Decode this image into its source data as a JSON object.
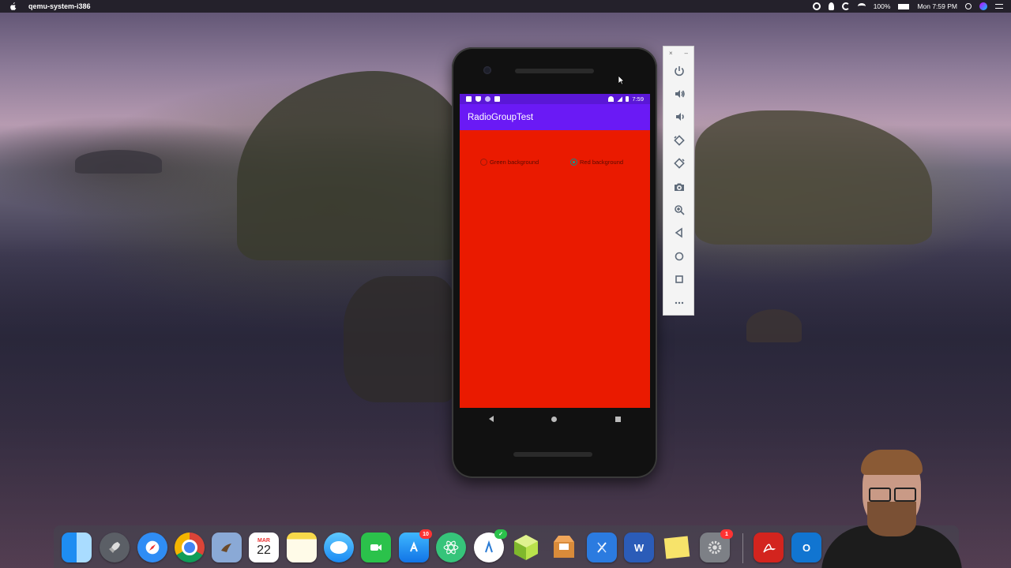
{
  "menubar": {
    "app_name": "qemu-system-i386",
    "battery": "100%",
    "clock": "Mon 7:59 PM"
  },
  "phone": {
    "status_time": "7:59",
    "app_title": "RadioGroupTest",
    "background_color": "#ea1a00",
    "radios": [
      {
        "label": "Green background",
        "checked": false
      },
      {
        "label": "Red background",
        "checked": true
      }
    ]
  },
  "emulator_panel": {
    "close": "×",
    "minimize": "–",
    "buttons": [
      "power-icon",
      "volume-up-icon",
      "volume-down-icon",
      "rotate-left-icon",
      "rotate-right-icon",
      "camera-icon",
      "zoom-icon",
      "back-icon",
      "home-icon",
      "overview-icon",
      "more-icon"
    ]
  },
  "dock": {
    "calendar_month": "MAR",
    "calendar_day": "22",
    "appstore_badge": "10",
    "sysprefs_badge": "1",
    "word_letter": "W",
    "outlook_letter": "O"
  }
}
